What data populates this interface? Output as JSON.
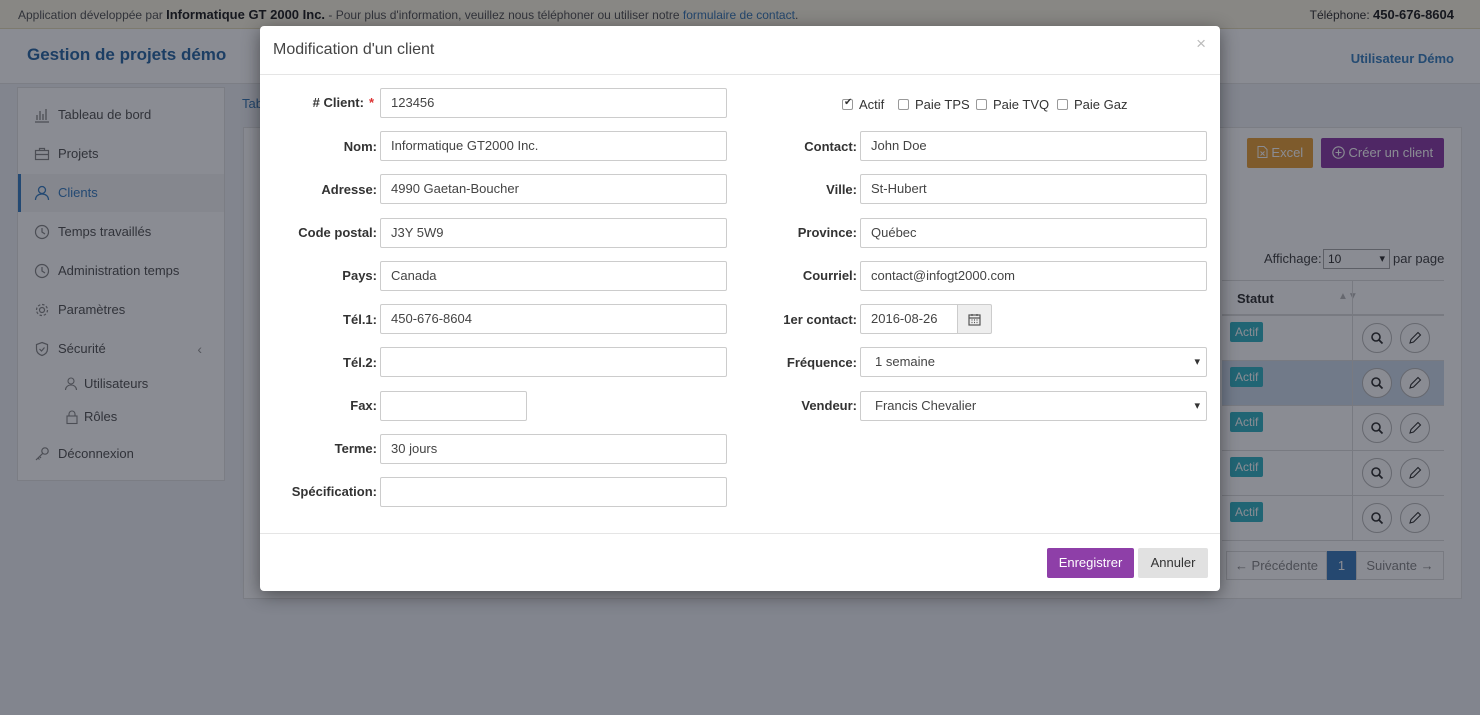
{
  "topbar": {
    "prefix": "Application développée par ",
    "company": "Informatique GT 2000 Inc.",
    "middle": " - Pour plus d'information, veuillez nous téléphoner ou utiliser notre ",
    "link": "formulaire de contact",
    "suffix": ".",
    "phone_label": "Téléphone: ",
    "phone": "450-676-8604"
  },
  "header": {
    "brand": "Gestion de projets démo",
    "user": "Utilisateur Démo"
  },
  "sidebar": {
    "items": [
      {
        "label": "Tableau de bord",
        "icon": "bar-chart-icon"
      },
      {
        "label": "Projets",
        "icon": "briefcase-icon"
      },
      {
        "label": "Clients",
        "icon": "user-icon"
      },
      {
        "label": "Temps travaillés",
        "icon": "clock-icon"
      },
      {
        "label": "Administration temps",
        "icon": "clock-icon"
      },
      {
        "label": "Paramètres",
        "icon": "gear-icon"
      },
      {
        "label": "Sécurité",
        "icon": "shield-icon"
      },
      {
        "label": "Utilisateurs",
        "icon": "users-icon"
      },
      {
        "label": "Rôles",
        "icon": "lock-icon"
      },
      {
        "label": "Déconnexion",
        "icon": "key-icon"
      }
    ],
    "chevron": "‹"
  },
  "content": {
    "tab": "Tab",
    "excel_label": "Excel",
    "create_label": "Créer un client",
    "show_label": "Affichage:",
    "show_value": "10",
    "per_page": "par page",
    "status_header": "Statut",
    "badge": "Actif",
    "prev": "← Précédente",
    "page": "1",
    "next": "Suivante →"
  },
  "modal": {
    "title": "Modification d'un client",
    "close": "×",
    "save": "Enregistrer",
    "cancel": "Annuler",
    "required_mark": "*",
    "left_fields": [
      {
        "label": "# Client:",
        "value": "123456"
      },
      {
        "label": "Nom:",
        "value": "Informatique GT2000 Inc."
      },
      {
        "label": "Adresse:",
        "value": "4990 Gaetan-Boucher"
      },
      {
        "label": "Code postal:",
        "value": "J3Y 5W9"
      },
      {
        "label": "Pays:",
        "value": "Canada"
      },
      {
        "label": "Tél.1:",
        "value": "450-676-8604"
      },
      {
        "label": "Tél.2:",
        "value": ""
      },
      {
        "label": "Fax:",
        "value": ""
      },
      {
        "label": "Terme:",
        "value": "30 jours"
      },
      {
        "label": "Spécification:",
        "value": ""
      }
    ],
    "checkboxes": [
      {
        "label": "Actif",
        "checked": true
      },
      {
        "label": "Paie TPS",
        "checked": false
      },
      {
        "label": "Paie TVQ",
        "checked": false
      },
      {
        "label": "Paie Gaz",
        "checked": false
      }
    ],
    "right_fields": [
      {
        "label": "Contact:",
        "value": "John Doe"
      },
      {
        "label": "Ville:",
        "value": "St-Hubert"
      },
      {
        "label": "Province:",
        "value": "Québec"
      },
      {
        "label": "Courriel:",
        "value": "contact@infogt2000.com"
      },
      {
        "label": "1er contact:",
        "value": "2016-08-26"
      },
      {
        "label": "Fréquence:",
        "value": "1 semaine"
      },
      {
        "label": "Vendeur:",
        "value": "Francis Chevalier"
      }
    ]
  }
}
